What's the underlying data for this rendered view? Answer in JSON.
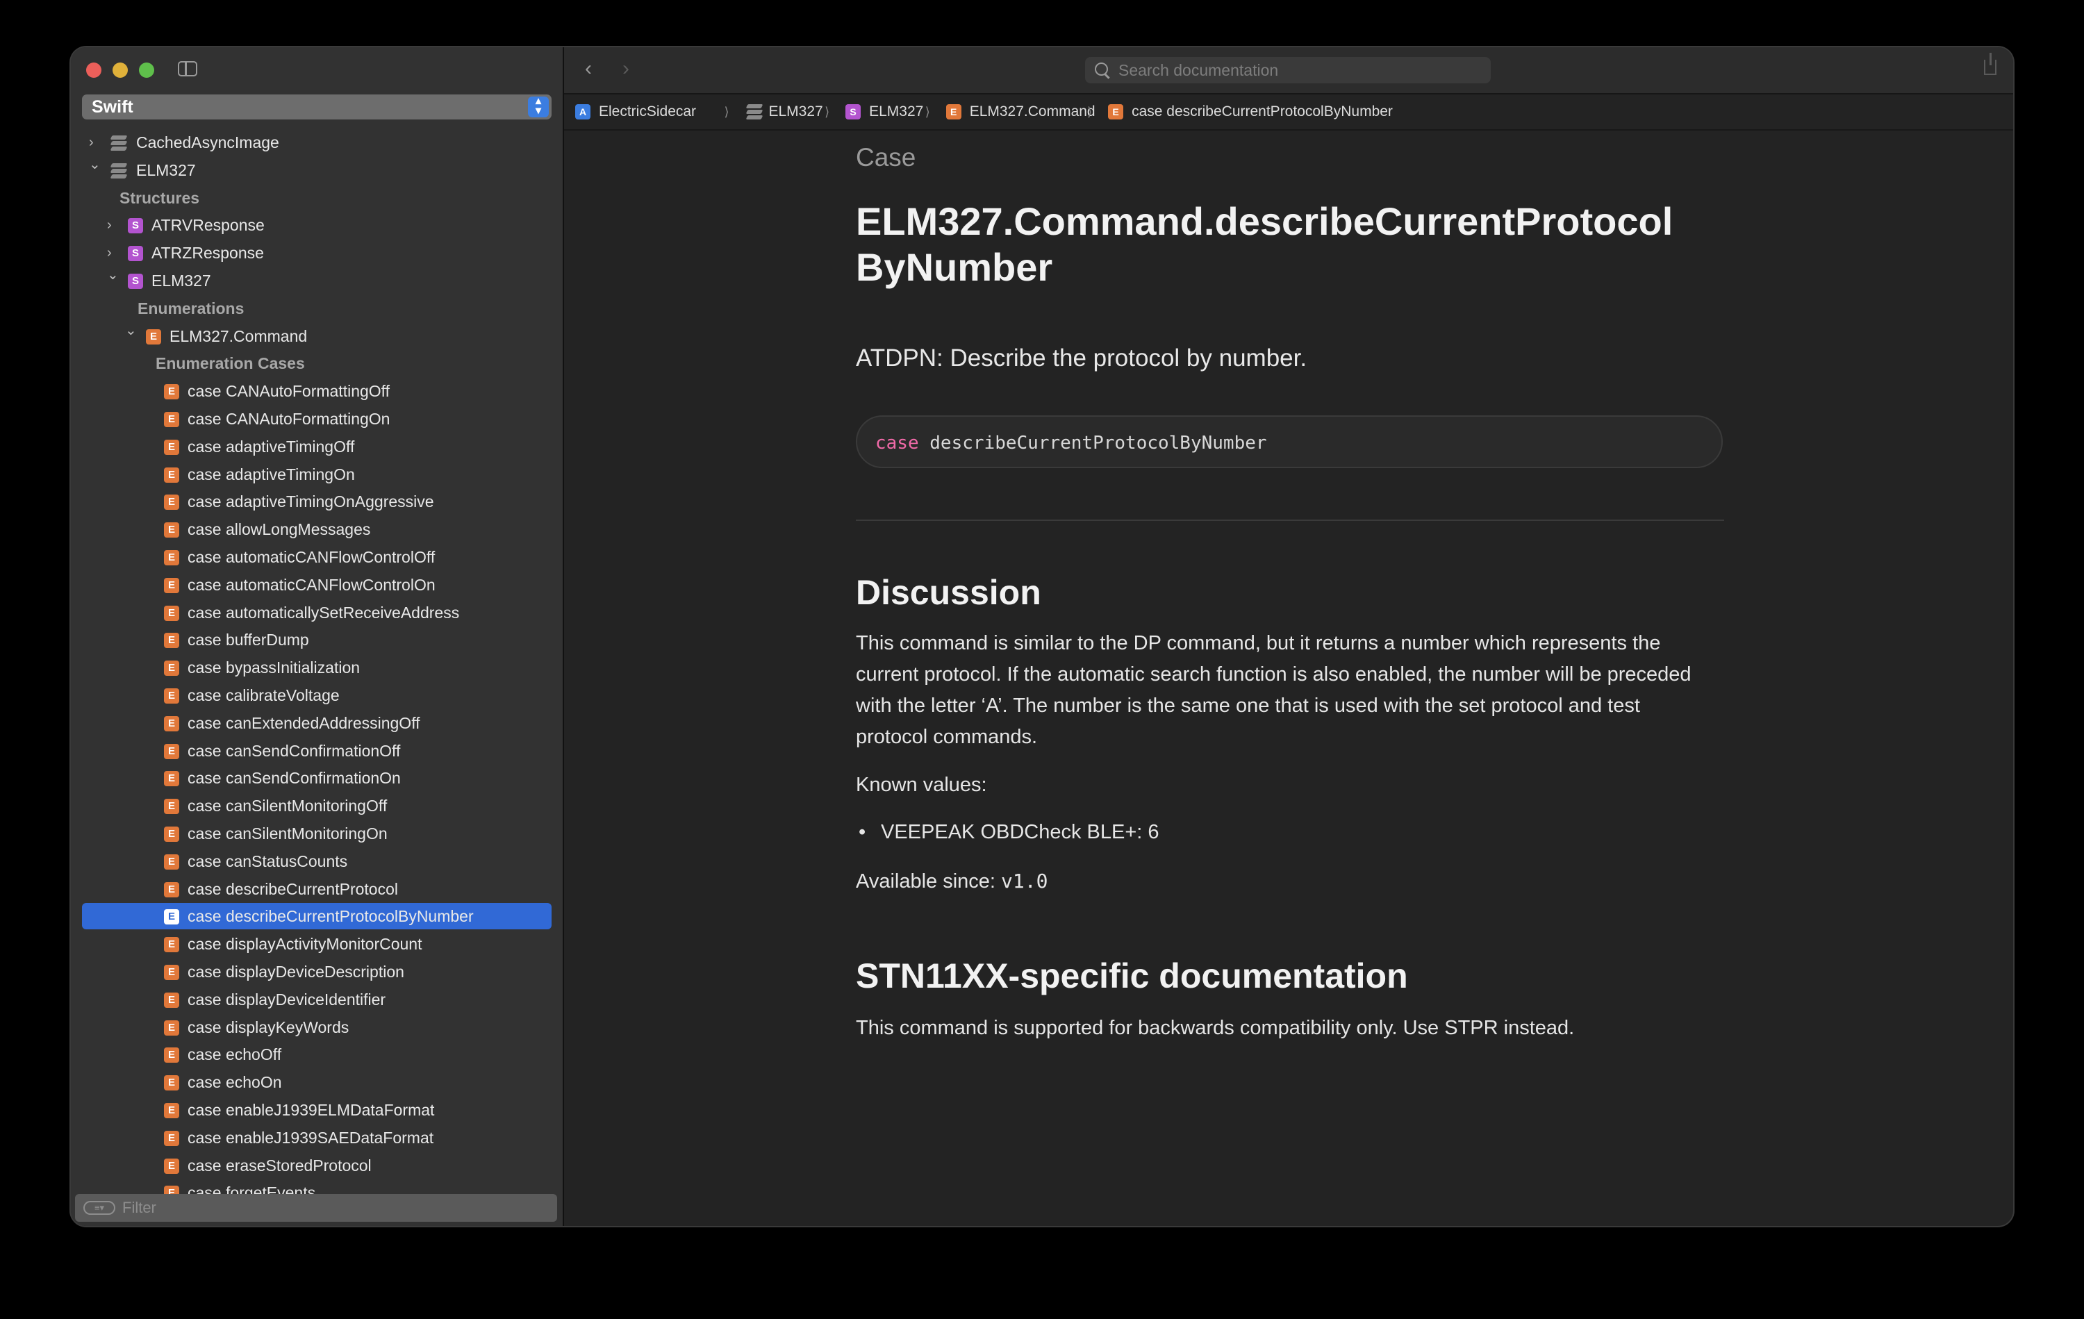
{
  "sidebar": {
    "language": "Swift",
    "tree": [
      {
        "label": "CachedAsyncImage",
        "type": "module",
        "chevron": "right"
      },
      {
        "label": "ELM327",
        "type": "module",
        "chevron": "down"
      },
      {
        "label": "Structures",
        "type": "heading"
      },
      {
        "label": "ATRVResponse",
        "type": "S",
        "chevron": "right"
      },
      {
        "label": "ATRZResponse",
        "type": "S",
        "chevron": "right"
      },
      {
        "label": "ELM327",
        "type": "S",
        "chevron": "down"
      },
      {
        "label": "Enumerations",
        "type": "heading"
      },
      {
        "label": "ELM327.Command",
        "type": "E",
        "chevron": "down"
      },
      {
        "label": "Enumeration Cases",
        "type": "heading"
      },
      {
        "label": "case CANAutoFormattingOff",
        "type": "E"
      },
      {
        "label": "case CANAutoFormattingOn",
        "type": "E"
      },
      {
        "label": "case adaptiveTimingOff",
        "type": "E"
      },
      {
        "label": "case adaptiveTimingOn",
        "type": "E"
      },
      {
        "label": "case adaptiveTimingOnAggressive",
        "type": "E"
      },
      {
        "label": "case allowLongMessages",
        "type": "E"
      },
      {
        "label": "case automaticCANFlowControlOff",
        "type": "E"
      },
      {
        "label": "case automaticCANFlowControlOn",
        "type": "E"
      },
      {
        "label": "case automaticallySetReceiveAddress",
        "type": "E"
      },
      {
        "label": "case bufferDump",
        "type": "E"
      },
      {
        "label": "case bypassInitialization",
        "type": "E"
      },
      {
        "label": "case calibrateVoltage",
        "type": "E"
      },
      {
        "label": "case canExtendedAddressingOff",
        "type": "E"
      },
      {
        "label": "case canSendConfirmationOff",
        "type": "E"
      },
      {
        "label": "case canSendConfirmationOn",
        "type": "E"
      },
      {
        "label": "case canSilentMonitoringOff",
        "type": "E"
      },
      {
        "label": "case canSilentMonitoringOn",
        "type": "E"
      },
      {
        "label": "case canStatusCounts",
        "type": "E"
      },
      {
        "label": "case describeCurrentProtocol",
        "type": "E"
      },
      {
        "label": "case describeCurrentProtocolByNumber",
        "type": "E",
        "selected": true
      },
      {
        "label": "case displayActivityMonitorCount",
        "type": "E"
      },
      {
        "label": "case displayDeviceDescription",
        "type": "E"
      },
      {
        "label": "case displayDeviceIdentifier",
        "type": "E"
      },
      {
        "label": "case displayKeyWords",
        "type": "E"
      },
      {
        "label": "case echoOff",
        "type": "E"
      },
      {
        "label": "case echoOn",
        "type": "E"
      },
      {
        "label": "case enableJ1939ELMDataFormat",
        "type": "E"
      },
      {
        "label": "case enableJ1939SAEDataFormat",
        "type": "E"
      },
      {
        "label": "case eraseStoredProtocol",
        "type": "E"
      },
      {
        "label": "case forgetEvents",
        "type": "E"
      }
    ],
    "filter_placeholder": "Filter"
  },
  "toolbar": {
    "search_placeholder": "Search documentation"
  },
  "breadcrumb": [
    {
      "label": "ElectricSidecar",
      "type": "A"
    },
    {
      "label": "ELM327",
      "type": "module"
    },
    {
      "label": "ELM327",
      "type": "S"
    },
    {
      "label": "ELM327.Command",
      "type": "E"
    },
    {
      "label": "case describeCurrentProtocolByNumber",
      "type": "E"
    }
  ],
  "doc": {
    "kind": "Case",
    "title_line1": "ELM327.Command.describeCurrentProtocol",
    "title_line2": "ByNumber",
    "abstract": "ATDPN: Describe the protocol by number.",
    "declaration_keyword": "case",
    "declaration_name": "describeCurrentProtocolByNumber",
    "discussion_heading": "Discussion",
    "discussion_lines": [
      "This command is similar to the DP command, but it returns a number which represents the",
      "current protocol. If the automatic search function is also enabled, the number will be preceded",
      "with the letter ‘A’. The number is the same one that is used with the set protocol and test",
      "protocol commands."
    ],
    "known_values_label": "Known values:",
    "known_values": [
      "VEEPEAK OBDCheck BLE+: 6"
    ],
    "available_label": "Available since:",
    "available_version": "v1.0",
    "stn_heading": "STN11XX-specific documentation",
    "stn_text": "This command is supported for backwards compatibility only. Use STPR instead."
  },
  "colors": {
    "accent": "#3169d6",
    "enum_badge": "#e1783a",
    "struct_badge": "#b354cf",
    "keyword": "#f06aa8"
  }
}
